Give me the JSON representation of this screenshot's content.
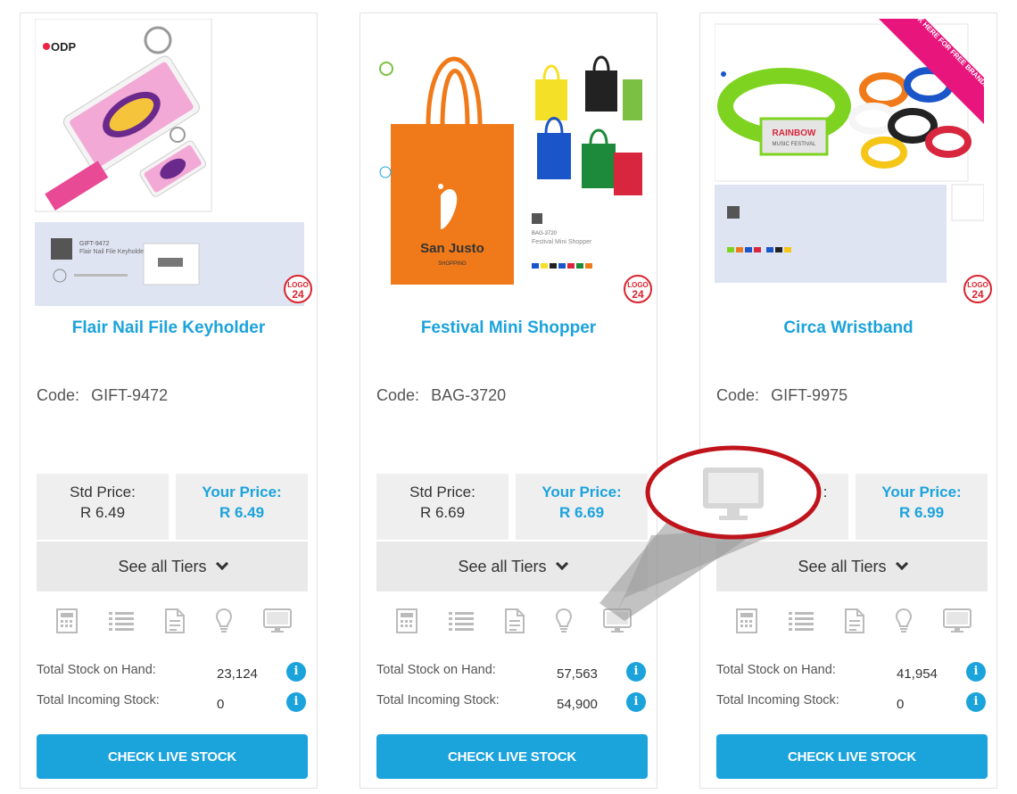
{
  "products": [
    {
      "name": "Flair Nail File Keyholder",
      "code_label": "Code:",
      "code": "GIFT-9472",
      "std_price_label": "Std Price:",
      "std_price": "R 6.49",
      "your_price_label": "Your Price:",
      "your_price": "R 6.49",
      "tiers_label": "See all Tiers",
      "stock_on_hand_label": "Total Stock on Hand:",
      "stock_on_hand": "23,124",
      "incoming_label": "Total Incoming Stock:",
      "incoming": "0",
      "button": "CHECK LIVE STOCK",
      "img_brand": "ODP",
      "img_sku": "GIFT-9472",
      "img_desc": "Flair Nail File Keyholder"
    },
    {
      "name": "Festival Mini Shopper",
      "code_label": "Code:",
      "code": "BAG-3720",
      "std_price_label": "Std Price:",
      "std_price": "R 6.69",
      "your_price_label": "Your Price:",
      "your_price": "R 6.69",
      "tiers_label": "See all Tiers",
      "stock_on_hand_label": "Total Stock on Hand:",
      "stock_on_hand": "57,563",
      "incoming_label": "Total Incoming Stock:",
      "incoming": "54,900",
      "button": "CHECK LIVE STOCK",
      "img_text": "San Justo",
      "img_sub": "SHOPPING",
      "img_sku": "BAG-3720",
      "img_desc": "Festival Mini Shopper"
    },
    {
      "name": "Circa Wristband",
      "code_label": "Code:",
      "code": "GIFT-9975",
      "std_price_label": "",
      "std_price": "",
      "your_price_label": "Your Price:",
      "your_price": "R 6.99",
      "tiers_label": "See all Tiers",
      "stock_on_hand_label": "Total Stock on Hand:",
      "stock_on_hand": "41,954",
      "incoming_label": "Total Incoming Stock:",
      "incoming": "0",
      "button": "CHECK LIVE STOCK",
      "img_banner": "CLICK HERE FOR FREE BRANDING INFO",
      "img_text": "RAINBOW",
      "img_sub": "MUSIC FESTIVAL"
    }
  ],
  "badge": {
    "top": "LOGO",
    "bottom": "24"
  },
  "colors": {
    "accent": "#1ba3dc",
    "callout": "#c0141c",
    "price_bg": "#efefef",
    "tiers_bg": "#e9e9e9"
  },
  "icons": [
    "calculator-icon",
    "list-icon",
    "document-icon",
    "lightbulb-icon",
    "monitor-icon"
  ]
}
